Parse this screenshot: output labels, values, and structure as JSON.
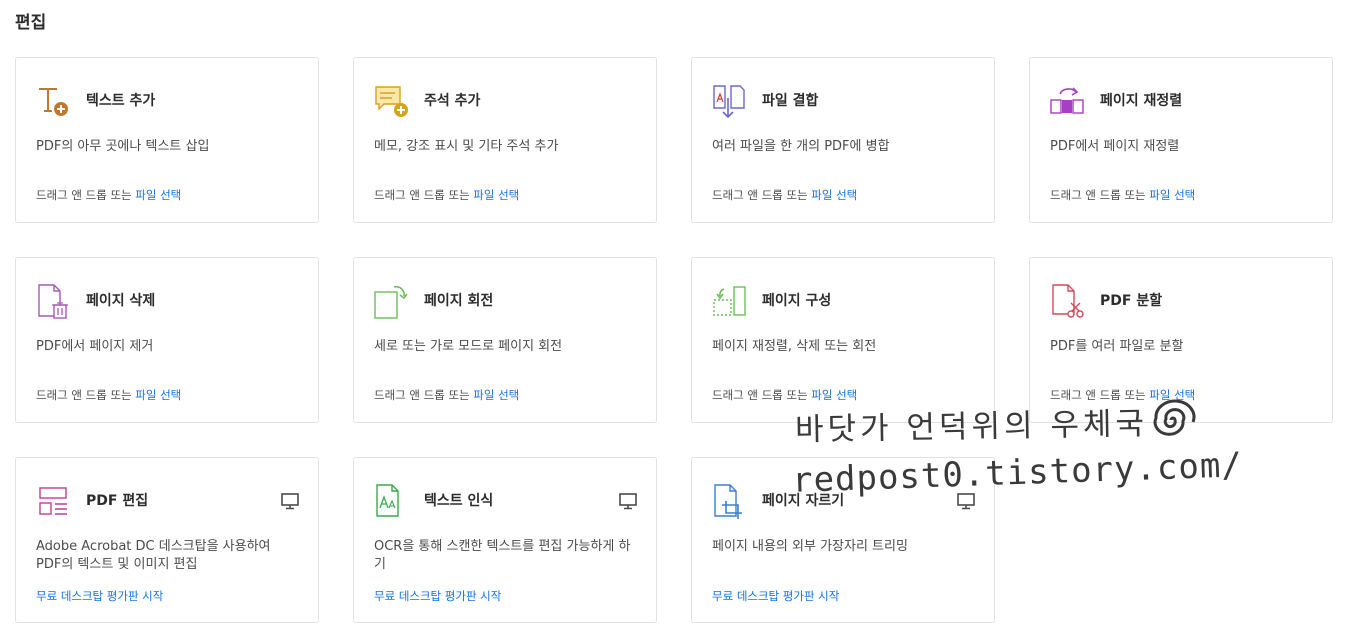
{
  "section_title": "편집",
  "cards": [
    {
      "title": "텍스트 추가",
      "desc": "PDF의 아무 곳에나 텍스트 삽입",
      "action_prefix": "드래그 앤 드롭 또는 ",
      "action_link": "파일 선택"
    },
    {
      "title": "주석 추가",
      "desc": "메모, 강조 표시 및 기타 주석 추가",
      "action_prefix": "드래그 앤 드롭 또는 ",
      "action_link": "파일 선택"
    },
    {
      "title": "파일 결합",
      "desc": "여러 파일을 한 개의 PDF에 병합",
      "action_prefix": "드래그 앤 드롭 또는 ",
      "action_link": "파일 선택"
    },
    {
      "title": "페이지 재정렬",
      "desc": "PDF에서 페이지 재정렬",
      "action_prefix": "드래그 앤 드롭 또는 ",
      "action_link": "파일 선택"
    },
    {
      "title": "페이지 삭제",
      "desc": "PDF에서 페이지 제거",
      "action_prefix": "드래그 앤 드롭 또는 ",
      "action_link": "파일 선택"
    },
    {
      "title": "페이지 회전",
      "desc": "세로 또는 가로 모드로 페이지 회전",
      "action_prefix": "드래그 앤 드롭 또는 ",
      "action_link": "파일 선택"
    },
    {
      "title": "페이지 구성",
      "desc": "페이지 재정렬, 삭제 또는 회전",
      "action_prefix": "드래그 앤 드롭 또는 ",
      "action_link": "파일 선택"
    },
    {
      "title": "PDF 분할",
      "desc": "PDF를 여러 파일로 분할",
      "action_prefix": "드래그 앤 드롭 또는 ",
      "action_link": "파일 선택"
    },
    {
      "title": "PDF 편집",
      "desc": "Adobe Acrobat DC 데스크탑을 사용하여 PDF의 텍스트 및 이미지 편집",
      "action_prefix": "",
      "action_link": "무료 데스크탑 평가판 시작"
    },
    {
      "title": "텍스트 인식",
      "desc": "OCR을 통해 스캔한 텍스트를 편집 가능하게 하기",
      "action_prefix": "",
      "action_link": "무료 데스크탑 평가판 시작"
    },
    {
      "title": "페이지 자르기",
      "desc": "페이지 내용의 외부 가장자리 트리밍",
      "action_prefix": "",
      "action_link": "무료 데스크탑 평가판 시작"
    }
  ],
  "watermark": {
    "line1": "바닷가 언덕위의 우체국",
    "line2": "redpost0.tistory.com/"
  },
  "icons": {
    "add-text": "text-plus-icon",
    "add-comment": "comment-plus-icon",
    "combine": "combine-files-icon",
    "reorder": "reorder-pages-icon",
    "delete": "page-trash-icon",
    "rotate": "page-rotate-icon",
    "organize": "organize-pages-icon",
    "split": "page-scissors-icon",
    "edit": "edit-layout-icon",
    "ocr": "ocr-text-icon",
    "crop": "crop-page-icon",
    "desktop": "monitor-icon"
  },
  "colors": {
    "link": "#1473e6",
    "border": "#e1e1e1",
    "text": "#2c2c2c"
  }
}
